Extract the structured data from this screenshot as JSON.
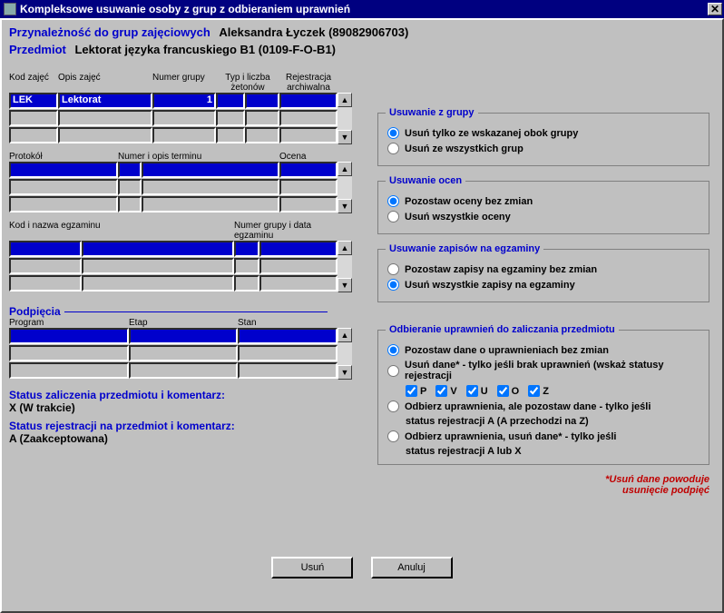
{
  "title": "Kompleksowe usuwanie osoby z grup z odbieraniem uprawnień",
  "header": {
    "membership_label": "Przynależność do grup zajęciowych",
    "person": "Aleksandra Łyczek (89082906703)",
    "subject_label": "Przedmiot",
    "subject": "Lektorat języka francuskiego B1 (0109-F-O-B1)"
  },
  "grid1": {
    "headers": {
      "kod": "Kod zajęć",
      "opis": "Opis zajęć",
      "numer": "Numer grupy",
      "typ": "Typ i liczba żetonów",
      "rej": "Rejestracja archiwalna"
    },
    "rows": [
      {
        "kod": "LEK",
        "opis": "Lektorat",
        "numer": "1",
        "typ": "",
        "rej": ""
      },
      {
        "kod": "",
        "opis": "",
        "numer": "",
        "typ": "",
        "rej": ""
      },
      {
        "kod": "",
        "opis": "",
        "numer": "",
        "typ": "",
        "rej": ""
      }
    ]
  },
  "grid2": {
    "headers": {
      "protokol": "Protokół",
      "numer": "Numer i opis terminu",
      "ocena": "Ocena"
    },
    "rows": [
      {
        "protokol": "",
        "numer": "",
        "ocena": ""
      },
      {
        "protokol": "",
        "numer": "",
        "ocena": ""
      },
      {
        "protokol": "",
        "numer": "",
        "ocena": ""
      }
    ]
  },
  "grid3": {
    "headers": {
      "kod": "Kod i nazwa egzaminu",
      "numer": "Numer grupy i data egzaminu"
    },
    "rows": [
      {
        "kod": "",
        "nazwa": "",
        "grupa": "",
        "data": ""
      },
      {
        "kod": "",
        "nazwa": "",
        "grupa": "",
        "data": ""
      },
      {
        "kod": "",
        "nazwa": "",
        "grupa": "",
        "data": ""
      }
    ]
  },
  "podpiecia": {
    "title": "Podpięcia",
    "headers": {
      "program": "Program",
      "etap": "Etap",
      "stan": "Stan"
    },
    "rows": [
      {
        "program": "",
        "etap": "",
        "stan": ""
      },
      {
        "program": "",
        "etap": "",
        "stan": ""
      },
      {
        "program": "",
        "etap": "",
        "stan": ""
      }
    ]
  },
  "status": {
    "zal_label": "Status zaliczenia przedmiotu i komentarz:",
    "zal_value": "X (W trakcie)",
    "rej_label": "Status rejestracji na przedmiot i komentarz:",
    "rej_value": "A (Zaakceptowana)"
  },
  "groups": {
    "usuwanie_grupy": {
      "legend": "Usuwanie z grupy",
      "opt1": "Usuń tylko ze wskazanej obok grupy",
      "opt2": "Usuń ze wszystkich grup"
    },
    "usuwanie_ocen": {
      "legend": "Usuwanie ocen",
      "opt1": "Pozostaw oceny bez zmian",
      "opt2": "Usuń wszystkie oceny"
    },
    "usuwanie_zapisow": {
      "legend": "Usuwanie zapisów na egzaminy",
      "opt1": "Pozostaw zapisy na egzaminy bez zmian",
      "opt2": "Usuń wszystkie zapisy na egzaminy"
    },
    "odbieranie": {
      "legend": "Odbieranie uprawnień do zaliczania przedmiotu",
      "opt1": "Pozostaw dane o uprawnieniach bez zmian",
      "opt2": "Usuń dane* - tylko jeśli brak uprawnień (wskaż statusy rejestracji",
      "chk_p": "P",
      "chk_v": "V",
      "chk_u": "U",
      "chk_o": "O",
      "chk_z": "Z",
      "opt3a": "Odbierz uprawnienia, ale pozostaw dane - tylko jeśli",
      "opt3b": "status rejestracji A (A przechodzi na Z)",
      "opt4a": "Odbierz uprawnienia, usuń dane* - tylko jeśli",
      "opt4b": "status rejestracji A lub X"
    }
  },
  "footnote_a": "*Usuń dane powoduje",
  "footnote_b": "usunięcie podpięć",
  "buttons": {
    "usun": "Usuń",
    "anuluj": "Anuluj"
  }
}
